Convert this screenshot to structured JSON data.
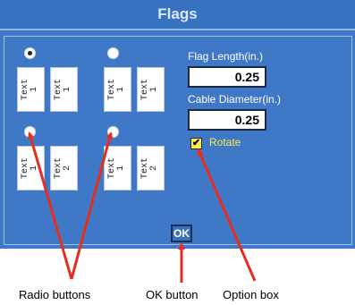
{
  "window": {
    "title": "Flags"
  },
  "radio_options": [
    {
      "selected": true,
      "flags": [
        [
          "Text",
          "1"
        ],
        [
          "Text",
          "1"
        ]
      ]
    },
    {
      "selected": false,
      "flags": [
        [
          "Text",
          "1"
        ],
        [
          "Text",
          "1"
        ]
      ]
    },
    {
      "selected": false,
      "flags": [
        [
          "Text",
          "1"
        ],
        [
          "Text",
          "2"
        ]
      ]
    },
    {
      "selected": false,
      "flags": [
        [
          "Text",
          "1"
        ],
        [
          "Text",
          "2"
        ]
      ]
    }
  ],
  "flag_length": {
    "label": "Flag Length(in.)",
    "value": "0.25"
  },
  "cable_diameter": {
    "label": "Cable Diameter(in.)",
    "value": "0.25"
  },
  "rotate": {
    "label": "Rotate",
    "checked": true
  },
  "ok_button": {
    "label": "OK"
  },
  "annotations": {
    "radio": "Radio  buttons",
    "ok": "OK button",
    "option": "Option  box"
  },
  "colors": {
    "dialog_bg": "#3f78c6",
    "title_text": "#dbe9ff",
    "rotate_text": "#ffe94a",
    "arrow": "#e52d20"
  }
}
